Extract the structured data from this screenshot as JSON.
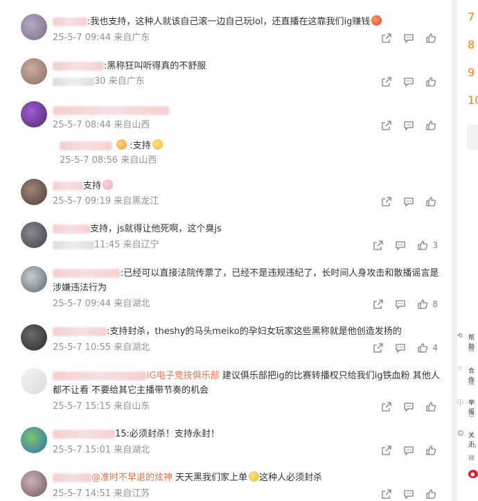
{
  "comments": [
    {
      "name": "",
      "text": ":我也支持，这种人就该自己滚一边自己玩lol，还直播在这靠我们ig赚钱",
      "date": "25-5-7 09:44",
      "loc": "来自广东",
      "likes": "",
      "avatar_color": "#8a7a96"
    },
    {
      "name": "",
      "text": ":黑称狂叫听得真的不舒服",
      "date": "30",
      "loc": "来自广东",
      "likes": "",
      "avatar_color": "#9c7e72"
    },
    {
      "name": "",
      "text": "",
      "date": "25-5-7 08:44",
      "loc": "来自山西",
      "likes": "",
      "avatar_color": "#6b3c8f"
    },
    {
      "name": "",
      "text": ":支持",
      "date": "25-5-7 08:56",
      "loc": "来自山西",
      "likes": "",
      "avatar_color": ""
    },
    {
      "name": "",
      "text": "支持",
      "date": "25-5-7 09:19",
      "loc": "来自黑龙江",
      "likes": "",
      "avatar_color": "#6e5a52"
    },
    {
      "name": "",
      "text": "支持，js就得让他死啊，这个臭js",
      "date": "11:45",
      "loc": "来自辽宁",
      "likes": "3",
      "avatar_color": "#5a5a62"
    },
    {
      "name": "",
      "text": ":已经可以直接法院传票了，已经不是违规违纪了，长时间人身攻击和散播谣言是涉嫌违法行为",
      "date": "25-5-7 09:44",
      "loc": "来自湖北",
      "likes": "8",
      "avatar_color": "#7f8790"
    },
    {
      "name": "",
      "text": ":支持封杀，theshy的马头meiko的孕妇女玩家这些黑称就是他创造发扬的",
      "date": "25-5-7 10:55",
      "loc": "来自湖北",
      "likes": "4",
      "avatar_color": "#3e3e3e"
    },
    {
      "name": "",
      "mention": "iG电子竞技俱乐部",
      "text": "建议俱乐部把ig的比赛转播权只给我们ig铁血粉 其他人都不让看 不要给其它主播带节奏的机会",
      "date": "25-5-7 15:15",
      "loc": "来自山东",
      "likes": "",
      "avatar_color": "#e6e6e6"
    },
    {
      "name": "",
      "text": "15:必须封杀！支持永封！",
      "date": "25-5-7 15:01",
      "loc": "来自湖北",
      "likes": "",
      "avatar_color": "#3f8fd6"
    },
    {
      "name": "",
      "mention": "@准时不早退的炫神",
      "text": "天天黑我们家上单",
      "text2": "这种人必须封杀",
      "date": "25-5-7 14:51",
      "loc": "来自江苏",
      "likes": "",
      "avatar_color": "#a08a8c"
    }
  ],
  "ranking_numbers": [
    "7",
    "8",
    "9",
    "10"
  ],
  "right_panel_labels": [
    "帮助",
    "微",
    "合作",
    "微",
    "举报",
    "违",
    "关于",
    "Ab",
    "微"
  ],
  "accent_color": "#eb7350"
}
